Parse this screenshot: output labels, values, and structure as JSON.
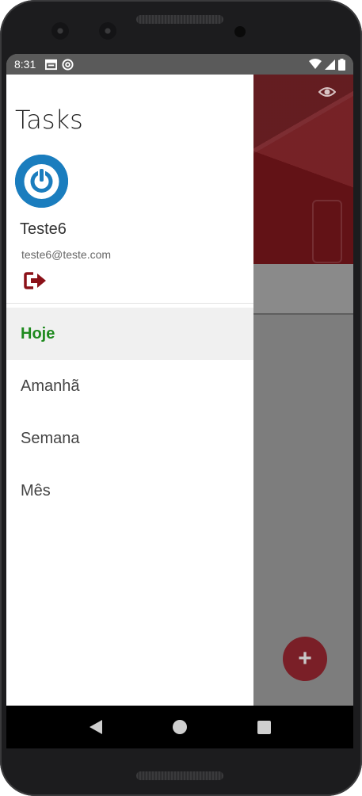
{
  "status_bar": {
    "time": "8:31",
    "icons": [
      "calendar-icon",
      "at-sign-icon",
      "wifi-icon",
      "signal-icon",
      "battery-icon"
    ]
  },
  "drawer": {
    "title": "Tasks",
    "user": {
      "name": "Teste6",
      "email": "teste6@teste.com"
    },
    "menu": [
      {
        "label": "Hoje",
        "active": true
      },
      {
        "label": "Amanhã",
        "active": false
      },
      {
        "label": "Semana",
        "active": false
      },
      {
        "label": "Mês",
        "active": false
      }
    ]
  },
  "background_app": {
    "fab_label": "+"
  },
  "colors": {
    "accent_active": "#1e8a1e",
    "logout": "#8b1118",
    "avatar": "#1a7dbe",
    "header": "#6d1419"
  }
}
